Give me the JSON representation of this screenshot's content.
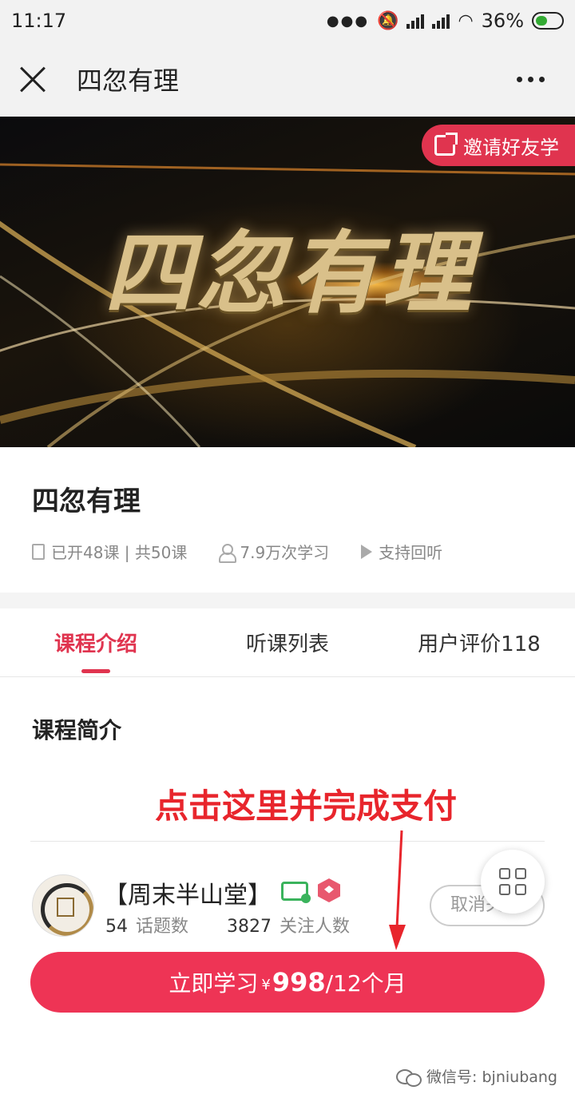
{
  "status_bar": {
    "time": "11:17",
    "battery": "36%"
  },
  "nav": {
    "title": "四忽有理"
  },
  "banner": {
    "title": "四忽有理",
    "invite_label": "邀请好友学"
  },
  "course": {
    "title": "四忽有理",
    "lessons": "已开48课 | 共50课",
    "learners": "7.9万次学习",
    "replay": "支持回听"
  },
  "tabs": [
    {
      "label": "课程介绍",
      "active": true
    },
    {
      "label": "听课列表",
      "active": false
    },
    {
      "label": "用户评价118",
      "active": false
    }
  ],
  "intro": {
    "section_title": "课程简介",
    "annotation": "点击这里并完成支付"
  },
  "author": {
    "name": "【周末半山堂】",
    "topics_count": "54",
    "topics_label": "话题数",
    "followers_count": "3827",
    "followers_label": "关注人数",
    "unfollow_label": "取消关"
  },
  "buy": {
    "label": "立即学习",
    "currency": "¥",
    "price": "998",
    "period": "/12个月"
  },
  "watermark": {
    "text": "微信号: bjniubang"
  },
  "colors": {
    "accent": "#e0344f",
    "buy_button": "#ee3455",
    "annotation": "#e8252c"
  }
}
